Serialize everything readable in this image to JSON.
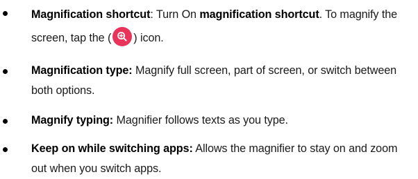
{
  "items": [
    {
      "term": "Magnification shortcut",
      "sep": ":",
      "text_a": " Turn On ",
      "inline_bold": "magnification shortcut",
      "text_b": ". To magnify the screen, tap the (",
      "icon": "magnifier-zoom-in-icon",
      "text_c": ") icon."
    },
    {
      "term": "Magnification type:",
      "text": " Magnify full screen, part of screen, or switch between both options."
    },
    {
      "term": "Magnify typing:",
      "text": " Magnifier follows texts as you type."
    },
    {
      "term": "Keep on while switching apps:",
      "text": " Allows the magnifier to stay on and zoom out when you switch apps."
    }
  ],
  "colors": {
    "icon_bg": "#e8345a",
    "icon_fg": "#ffffff",
    "text": "#1a1a1a"
  }
}
